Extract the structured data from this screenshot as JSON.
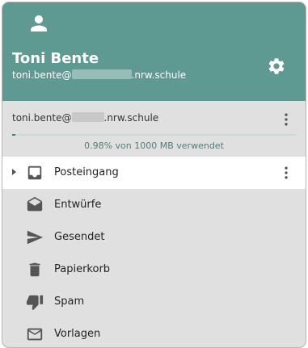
{
  "header": {
    "user_name": "Toni Bente",
    "email_prefix": "toni.bente@",
    "email_suffix": ".nrw.schule",
    "background_color": "#5e9a92",
    "icons": [
      "account-icon",
      "settings-gear-icon"
    ]
  },
  "account": {
    "email_prefix": "toni.bente@",
    "email_suffix": ".nrw.schule",
    "quota_text": "0.98% von 1000 MB verwendet",
    "quota_fraction": 0.0098,
    "menu_icon": "more-vert-icon"
  },
  "folders": [
    {
      "label": "Posteingang",
      "icon": "inbox-icon",
      "active": true
    },
    {
      "label": "Entwürfe",
      "icon": "drafts-icon",
      "active": false
    },
    {
      "label": "Gesendet",
      "icon": "send-icon",
      "active": false
    },
    {
      "label": "Papierkorb",
      "icon": "trash-icon",
      "active": false
    },
    {
      "label": "Spam",
      "icon": "thumb-down-icon",
      "active": false
    },
    {
      "label": "Vorlagen",
      "icon": "mail-outline-icon",
      "active": false
    }
  ]
}
